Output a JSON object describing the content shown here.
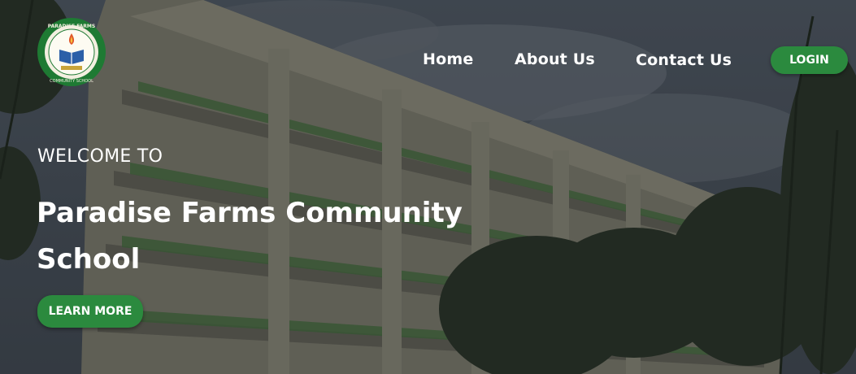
{
  "logo": {
    "text": "PARADISE FARMS COMMUNITY SCHOOL",
    "icon": "school-seal-icon"
  },
  "nav": {
    "items": [
      "Home",
      "About Us",
      "Contact Us"
    ],
    "login_label": "LOGIN"
  },
  "hero": {
    "welcome": "WELCOME TO",
    "title": "Paradise Farms Community School",
    "cta_label": "LEARN MORE"
  },
  "colors": {
    "accent": "#2b8a3e",
    "text": "#ffffff",
    "logo_ring": "#1e7a33"
  }
}
